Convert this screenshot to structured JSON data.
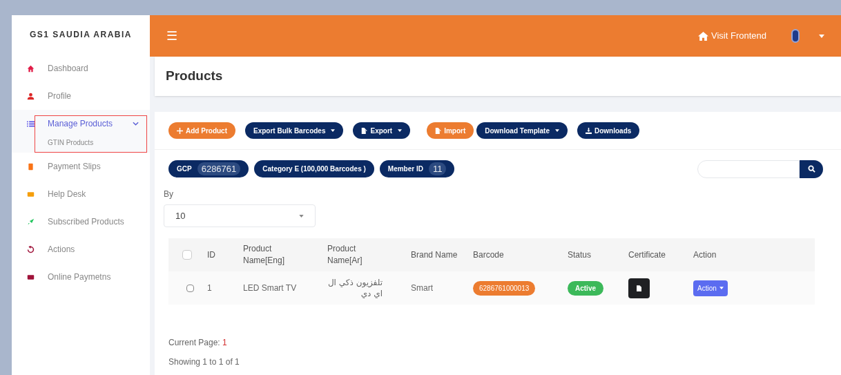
{
  "brand": "GS1 SAUDIA ARABIA",
  "sidebar": {
    "items": [
      {
        "label": "Dashboard",
        "kind": "home",
        "selected": false
      },
      {
        "label": "Profile",
        "kind": "user",
        "selected": false
      },
      {
        "label": "Manage Products",
        "kind": "list",
        "selected": true,
        "expanded": true,
        "highlighted": true,
        "children": [
          {
            "label": "GTIN Products",
            "selected": false
          }
        ]
      },
      {
        "label": "Payment Slips",
        "kind": "slip",
        "selected": false
      },
      {
        "label": "Help Desk",
        "kind": "ticket",
        "selected": false
      },
      {
        "label": "Subscribed Products",
        "kind": "rocket",
        "selected": false
      },
      {
        "label": "Actions",
        "kind": "history",
        "selected": false
      },
      {
        "label": "Online Paymetns",
        "kind": "card",
        "selected": false
      }
    ]
  },
  "topbar": {
    "menu_icon": "☰",
    "link": "Visit Frontend"
  },
  "page_title": "Products",
  "toolbar": [
    {
      "label": "Add Product",
      "kind": "add",
      "caret": false
    },
    {
      "label": "Export Bulk Barcodes",
      "kind": "menu",
      "caret": true
    },
    {
      "label": "Export",
      "kind": "export",
      "caret": true
    },
    {
      "label": "Import",
      "kind": "import",
      "caret": false
    },
    {
      "label": "Download Template",
      "kind": "menu",
      "caret": true
    },
    {
      "label": "Downloads",
      "kind": "download",
      "caret": false
    }
  ],
  "badges": [
    {
      "label": "GCP",
      "value": "6286761"
    },
    {
      "label": "Category E (100,000 Barcodes )"
    },
    {
      "label": "Member ID",
      "value": "11"
    }
  ],
  "per_page": {
    "label": "By",
    "value": "10"
  },
  "table": {
    "all_checked": false,
    "columns": [
      "ID",
      "Product Name[Eng]",
      "Product Name[Ar]",
      "Brand Name",
      "Barcode",
      "Status",
      "Certificate",
      "Action"
    ],
    "rows": [
      {
        "checked": false,
        "id": "1",
        "name_en": "LED Smart TV",
        "name_ar": "تلفزيون ذكي ال اي دي",
        "brand": "Smart",
        "barcode": "6286761000013",
        "status": "Active",
        "action": "Action"
      }
    ]
  },
  "footer": {
    "current_page_label": "Current Page:",
    "current_page": "1",
    "showing": "Showing 1 to 1 of 1"
  }
}
